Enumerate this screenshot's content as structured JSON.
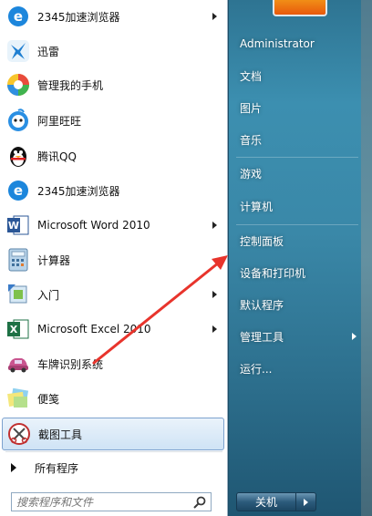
{
  "left_menu": {
    "items": [
      {
        "label": "2345加速浏览器",
        "icon": "browser-2345-icon",
        "submenu": true
      },
      {
        "label": "迅雷",
        "icon": "xunlei-icon",
        "submenu": false
      },
      {
        "label": "管理我的手机",
        "icon": "phone-manager-icon",
        "submenu": false
      },
      {
        "label": "阿里旺旺",
        "icon": "aliwangwang-icon",
        "submenu": false
      },
      {
        "label": "腾讯QQ",
        "icon": "qq-penguin-icon",
        "submenu": false
      },
      {
        "label": "2345加速浏览器",
        "icon": "browser-2345-icon",
        "submenu": false
      },
      {
        "label": "Microsoft Word 2010",
        "icon": "word-icon",
        "submenu": true
      },
      {
        "label": "计算器",
        "icon": "calculator-icon",
        "submenu": false
      },
      {
        "label": "入门",
        "icon": "getting-started-icon",
        "submenu": true
      },
      {
        "label": "Microsoft Excel 2010",
        "icon": "excel-icon",
        "submenu": true
      },
      {
        "label": "车牌识别系统",
        "icon": "car-icon",
        "submenu": false
      },
      {
        "label": "便笺",
        "icon": "sticky-notes-icon",
        "submenu": false
      },
      {
        "label": "截图工具",
        "icon": "snipping-tool-icon",
        "submenu": false,
        "selected": true
      }
    ],
    "all_programs_label": "所有程序",
    "search_placeholder": "搜索程序和文件"
  },
  "right_menu": {
    "items": [
      {
        "label": "Administrator",
        "submenu": false
      },
      {
        "label": "文档",
        "submenu": false
      },
      {
        "label": "图片",
        "submenu": false
      },
      {
        "label": "音乐",
        "submenu": false
      },
      {
        "label": "游戏",
        "submenu": false
      },
      {
        "label": "计算机",
        "submenu": false
      },
      {
        "label": "控制面板",
        "submenu": false
      },
      {
        "label": "设备和打印机",
        "submenu": false
      },
      {
        "label": "默认程序",
        "submenu": false
      },
      {
        "label": "管理工具",
        "submenu": true
      },
      {
        "label": "运行...",
        "submenu": false
      }
    ],
    "shutdown_label": "关机"
  },
  "colors": {
    "annotation_arrow": "#e8342c",
    "selected_highlight": "#cfe3f5",
    "right_pane": "#3a88a8"
  }
}
